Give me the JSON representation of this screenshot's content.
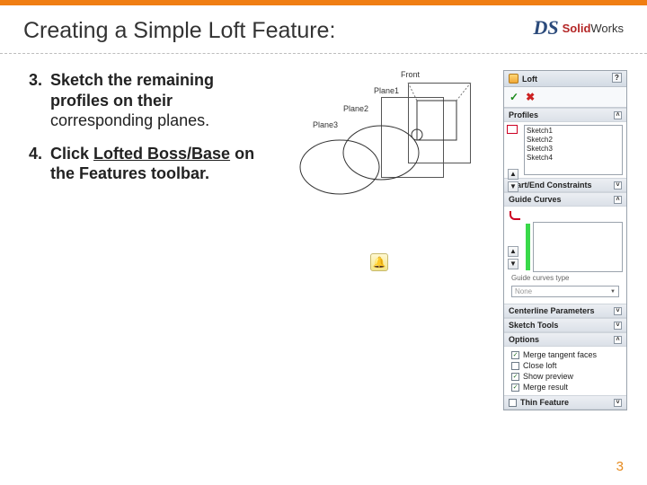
{
  "header": {
    "title": "Creating a Simple Loft Feature:",
    "brand_solid": "Solid",
    "brand_works": "Works",
    "brand_ds": "DS"
  },
  "steps": [
    {
      "n": 3,
      "prefix": "Sketch the remaining profiles on their",
      "light_suffix": "corresponding planes."
    },
    {
      "n": 4,
      "prefix": "Click ",
      "underline": "Lofted Boss/Base",
      "suffix": " on the Features toolbar."
    }
  ],
  "viewport_labels": {
    "front": "Front",
    "plane1": "Plane1",
    "plane2": "Plane2",
    "plane3": "Plane3"
  },
  "pm": {
    "title": "Loft",
    "sections": {
      "profiles": {
        "label": "Profiles",
        "items": [
          "Sketch1",
          "Sketch2",
          "Sketch3",
          "Sketch4"
        ]
      },
      "start_end": {
        "label": "Start/End Constraints"
      },
      "guide": {
        "label": "Guide Curves",
        "type_label": "Guide curves type",
        "type_value": "None"
      },
      "centerline": {
        "label": "Centerline Parameters"
      },
      "sketchtools": {
        "label": "Sketch Tools"
      },
      "options": {
        "label": "Options",
        "items": [
          {
            "key": "merge",
            "label": "Merge tangent faces",
            "checked": true
          },
          {
            "key": "close",
            "label": "Close loft",
            "checked": false
          },
          {
            "key": "preview",
            "label": "Show preview",
            "checked": true
          },
          {
            "key": "mergeres",
            "label": "Merge result",
            "checked": true
          }
        ]
      },
      "thin": {
        "label": "Thin Feature",
        "checked": false
      }
    }
  },
  "page_number": "3",
  "icons": {
    "bell": "🔔",
    "check": "✓",
    "cross": "✖",
    "qmark": "?",
    "up": "▲",
    "down": "▼"
  }
}
